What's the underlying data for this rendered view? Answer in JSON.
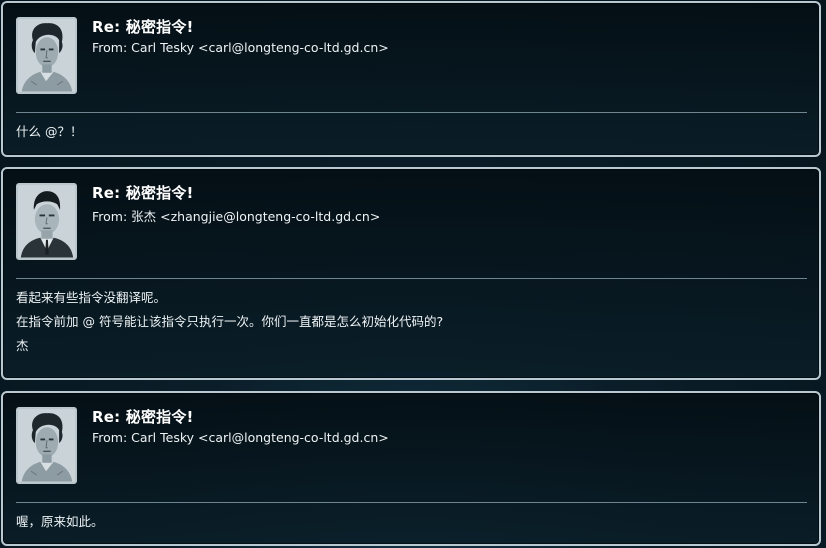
{
  "messages": [
    {
      "subject": "Re: 秘密指令!",
      "from": "From: Carl Tesky <carl@longteng-co-ltd.gd.cn>",
      "avatar_icon": "carl-portrait-avatar",
      "body": [
        "什么 @？！"
      ]
    },
    {
      "subject": "Re: 秘密指令!",
      "from": "From: 张杰 <zhangjie@longteng-co-ltd.gd.cn>",
      "avatar_icon": "zhangjie-portrait-avatar",
      "body": [
        "看起来有些指令没翻译呢。",
        "在指令前加 @ 符号能让该指令只执行一次。你们一直都是怎么初始化代码的?",
        "杰"
      ]
    },
    {
      "subject": "Re: 秘密指令!",
      "from": "From: Carl Tesky <carl@longteng-co-ltd.gd.cn>",
      "avatar_icon": "carl-portrait-avatar",
      "body": [
        "喔，原来如此。"
      ]
    }
  ],
  "colors": {
    "border": "#b8c9d1",
    "divider": "#6f8590",
    "background": "#0a1e29",
    "text": "#eef3f5"
  }
}
